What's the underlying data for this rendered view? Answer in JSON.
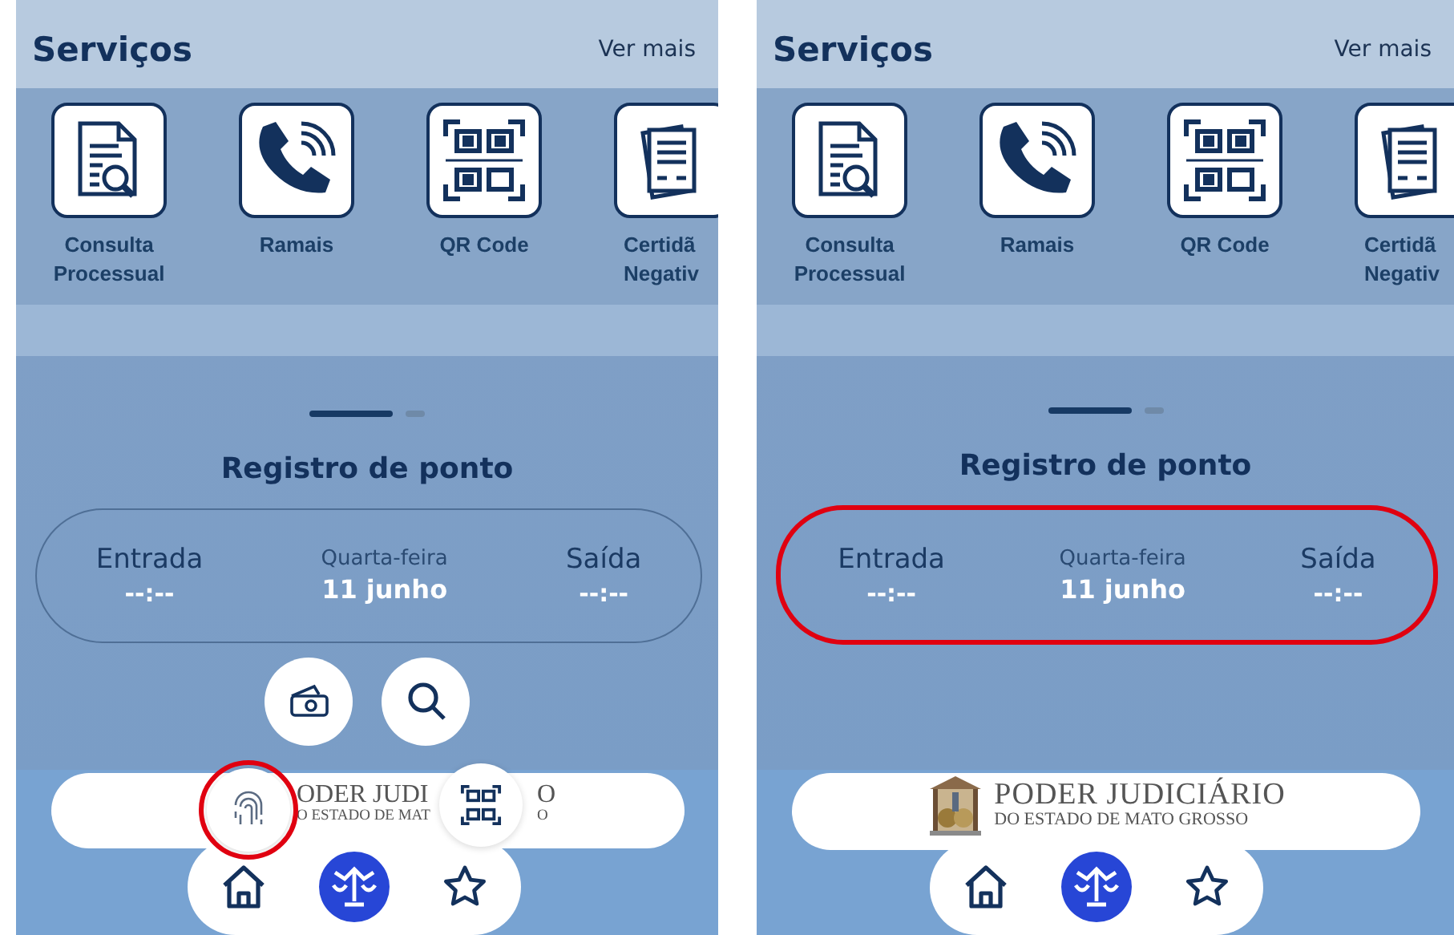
{
  "panels": [
    {
      "services": {
        "title": "Serviços",
        "more": "Ver mais",
        "items": [
          {
            "kind": "document-search",
            "label": "Consulta Processual"
          },
          {
            "kind": "phone",
            "label": "Ramais"
          },
          {
            "kind": "qr",
            "label": "QR Code"
          },
          {
            "kind": "certificate",
            "label": "Certidã Negativ"
          }
        ]
      },
      "dots": [
        {
          "selected": true
        },
        {
          "selected": false
        }
      ],
      "registro": {
        "title": "Registro de ponto",
        "entrada_label": "Entrada",
        "entrada_time": "--:--",
        "weekday": "Quarta-feira",
        "date": "11 junho",
        "saida_label": "Saída",
        "saida_time": "--:--",
        "highlighted": false
      },
      "fabs": [
        {
          "kind": "money"
        },
        {
          "kind": "search"
        }
      ],
      "logo": {
        "emblem": false,
        "fragments": [
          {
            "line1": "ODER JUDI",
            "line2": "O ESTADO DE MAT"
          },
          {
            "line1": "O",
            "line2": "O"
          }
        ]
      },
      "overlay_fabs": [
        {
          "kind": "fingerprint",
          "highlighted": true
        },
        {
          "kind": "qr",
          "highlighted": false
        }
      ],
      "nav": [
        {
          "kind": "home",
          "selected": false
        },
        {
          "kind": "scales",
          "selected": true
        },
        {
          "kind": "star",
          "selected": false
        }
      ]
    },
    {
      "services": {
        "title": "Serviços",
        "more": "Ver mais",
        "items": [
          {
            "kind": "document-search",
            "label": "Consulta Processual"
          },
          {
            "kind": "phone",
            "label": "Ramais"
          },
          {
            "kind": "qr",
            "label": "QR Code"
          },
          {
            "kind": "certificate",
            "label": "Certidã Negativ"
          }
        ]
      },
      "dots": [
        {
          "selected": true
        },
        {
          "selected": false
        }
      ],
      "registro": {
        "title": "Registro de ponto",
        "entrada_label": "Entrada",
        "entrada_time": "--:--",
        "weekday": "Quarta-feira",
        "date": "11 junho",
        "saida_label": "Saída",
        "saida_time": "--:--",
        "highlighted": true
      },
      "logo": {
        "emblem": true,
        "fragments": [
          {
            "line1": "PODER JUDICIÁRIO",
            "line2": "DO ESTADO DE MATO GROSSO"
          }
        ]
      },
      "nav": [
        {
          "kind": "home",
          "selected": false
        },
        {
          "kind": "scales",
          "selected": true
        },
        {
          "kind": "star",
          "selected": false
        }
      ]
    }
  ]
}
